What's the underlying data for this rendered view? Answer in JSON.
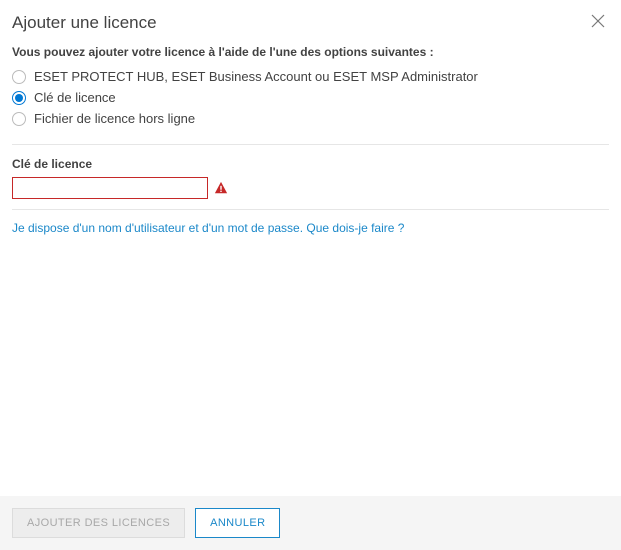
{
  "dialog": {
    "title": "Ajouter une licence",
    "instruction": "Vous pouvez ajouter votre licence à l'aide de l'une des options suivantes :",
    "options": {
      "hub": "ESET PROTECT HUB, ESET Business Account ou ESET MSP Administrator",
      "key": "Clé de licence",
      "offline": "Fichier de licence hors ligne"
    },
    "selectedOption": "key",
    "field": {
      "label": "Clé de licence",
      "value": ""
    },
    "helpLink": "Je dispose d'un nom d'utilisateur et d'un mot de passe. Que dois-je faire ?",
    "buttons": {
      "add": "AJOUTER DES LICENCES",
      "cancel": "ANNULER"
    }
  },
  "colors": {
    "accent": "#0078d4",
    "link": "#1b88c9",
    "error": "#c62828",
    "footerBg": "#f5f5f5"
  }
}
